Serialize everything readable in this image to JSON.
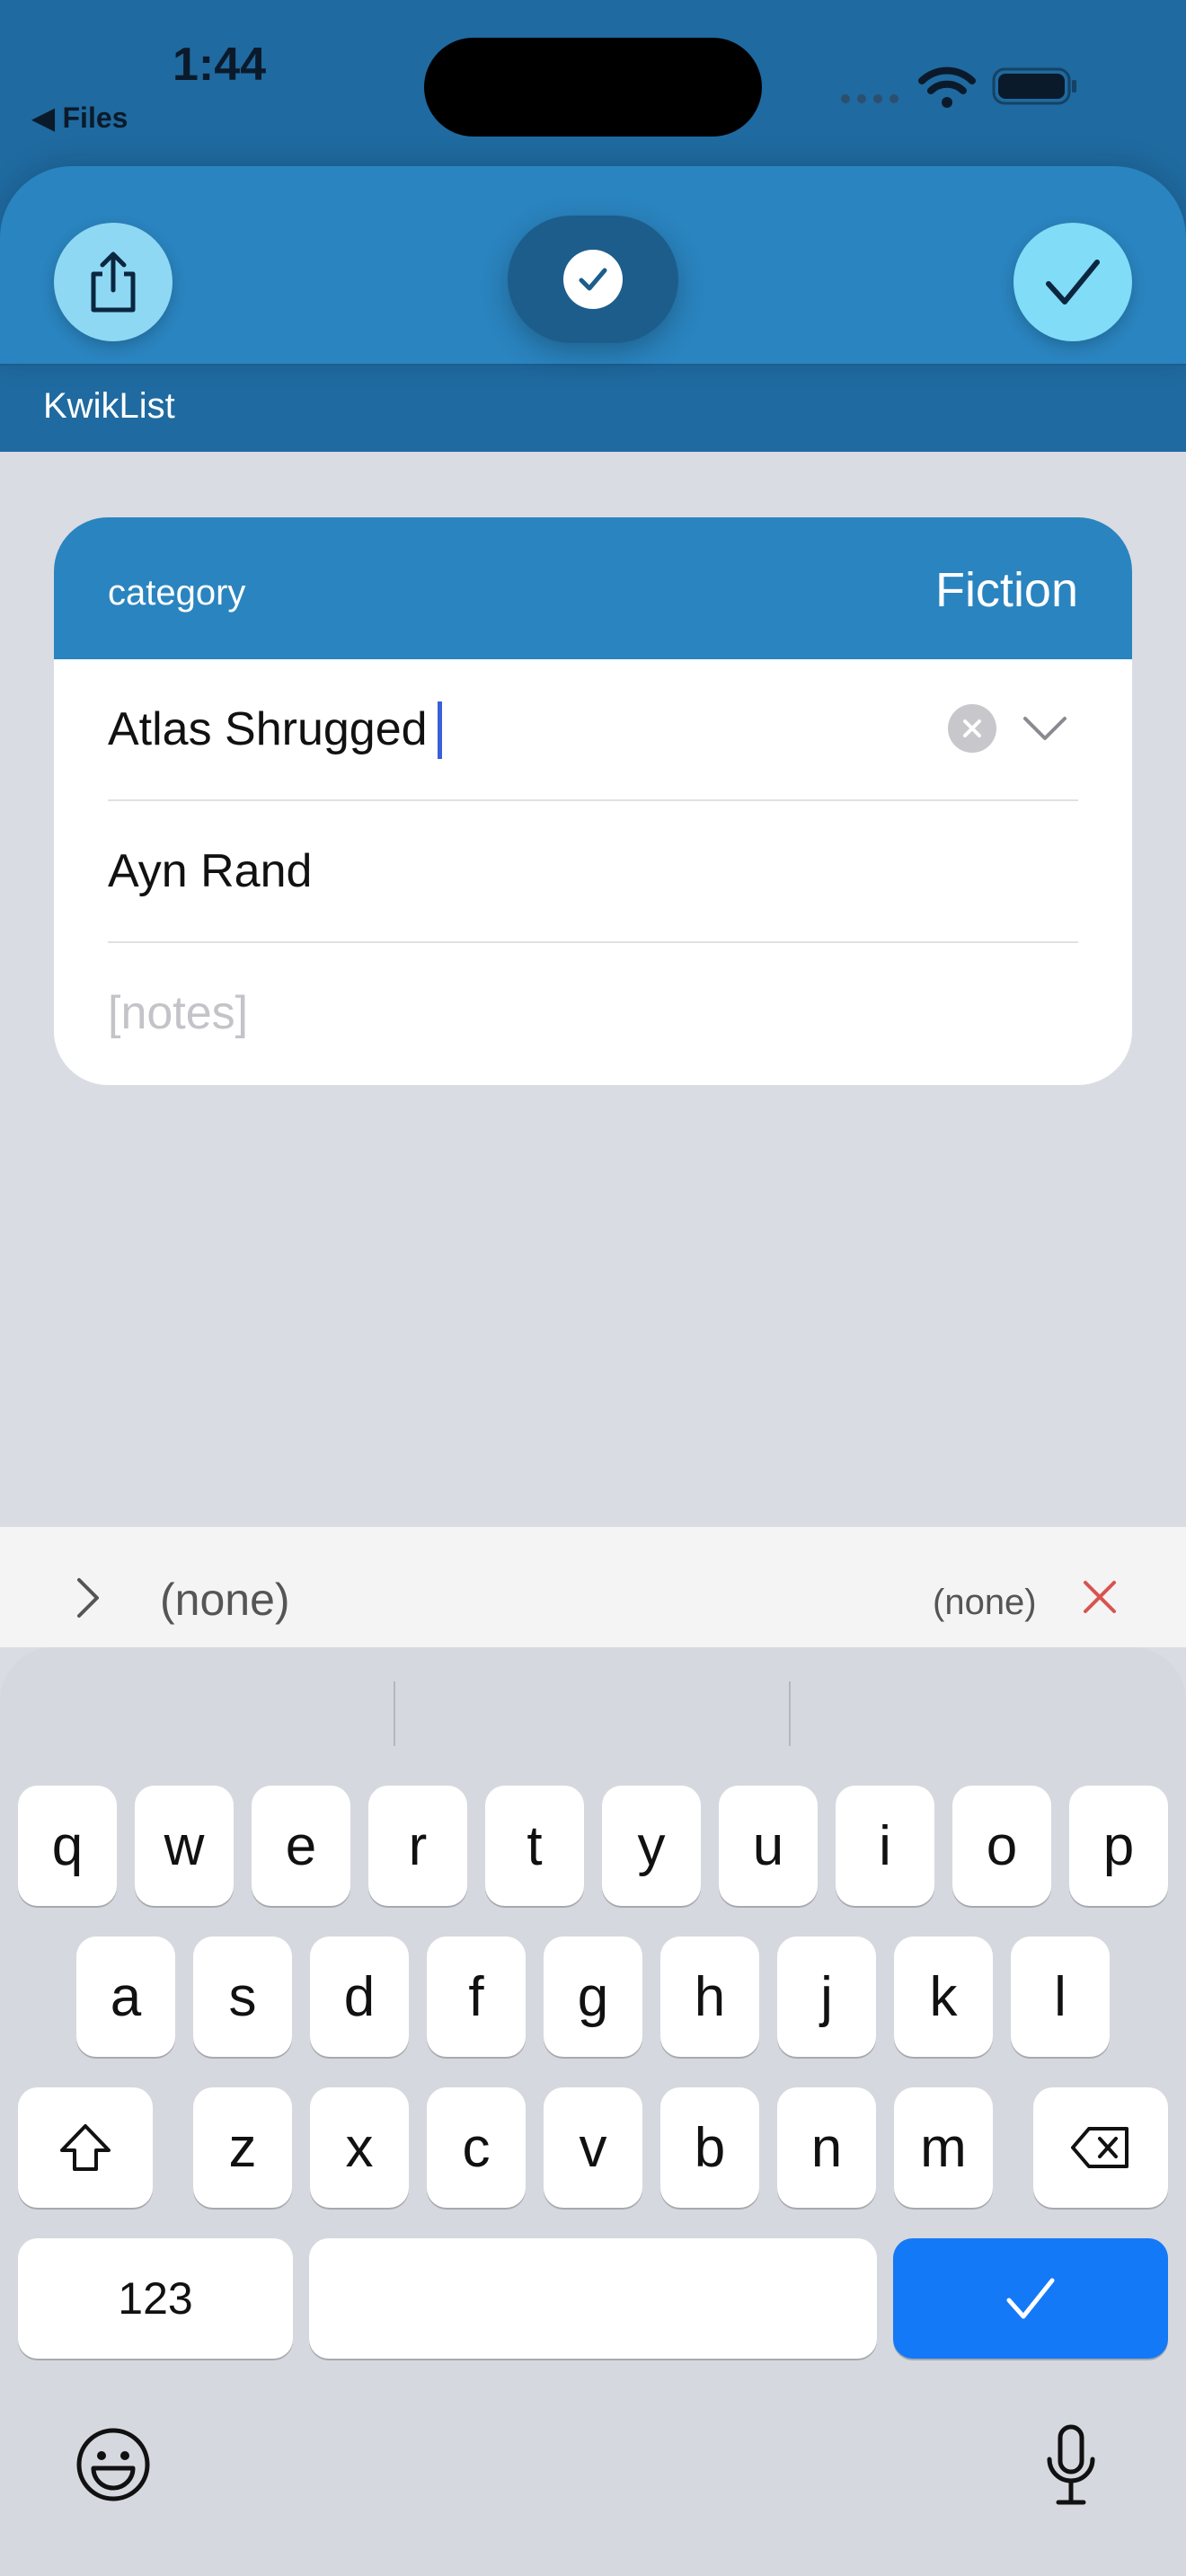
{
  "status_bar": {
    "time": "1:44",
    "back_label": "Files"
  },
  "nav": {
    "app_title": "KwikList"
  },
  "card": {
    "category_label": "category",
    "category_value": "Fiction",
    "title_value": "Atlas Shrugged",
    "author_value": "Ayn Rand",
    "notes_placeholder": "[notes]"
  },
  "suggestion_bar": {
    "left_text": "(none)",
    "right_text": "(none)"
  },
  "keyboard": {
    "row1": [
      "q",
      "w",
      "e",
      "r",
      "t",
      "y",
      "u",
      "i",
      "o",
      "p"
    ],
    "row2": [
      "a",
      "s",
      "d",
      "f",
      "g",
      "h",
      "j",
      "k",
      "l"
    ],
    "row3": [
      "z",
      "x",
      "c",
      "v",
      "b",
      "n",
      "m"
    ],
    "numbers_label": "123"
  },
  "colors": {
    "accent": "#2a84bf",
    "nav_dark": "#1f6aa0",
    "return_key": "#1479f6"
  },
  "icons": [
    "share-icon",
    "checkmark-icon",
    "clear-icon",
    "chevron-down-icon",
    "chevron-right-icon",
    "close-icon",
    "shift-icon",
    "delete-icon",
    "emoji-icon",
    "microphone-icon"
  ]
}
